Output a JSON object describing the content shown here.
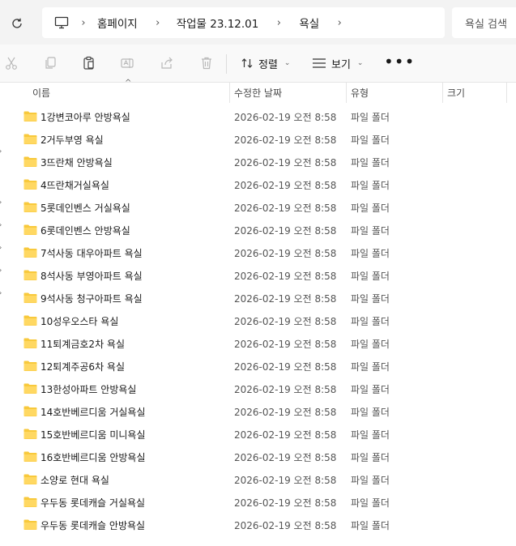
{
  "address": {
    "breadcrumbs": [
      "홈페이지",
      "작업물 23.12.01",
      "욕실"
    ],
    "search_placeholder": "욕실 검색"
  },
  "toolbar": {
    "sort_label": "정렬",
    "view_label": "보기",
    "icons": [
      "cut-icon",
      "copy-icon",
      "paste-icon",
      "rename-icon",
      "share-icon",
      "delete-icon"
    ]
  },
  "columns": {
    "name": "이름",
    "date": "수정한 날짜",
    "type": "유형",
    "size": "크기"
  },
  "folder_color": "#F8C93C",
  "files": [
    {
      "name": "1강변코아루 안방욕실",
      "date": "2026-02-19 오전 8:58",
      "type": "파일 폴더"
    },
    {
      "name": "2거두부영 욕실",
      "date": "2026-02-19 오전 8:58",
      "type": "파일 폴더"
    },
    {
      "name": "3뜨란채 안방욕실",
      "date": "2026-02-19 오전 8:58",
      "type": "파일 폴더"
    },
    {
      "name": "4뜨란채거실욕실",
      "date": "2026-02-19 오전 8:58",
      "type": "파일 폴더"
    },
    {
      "name": "5롯데인벤스 거실욕실",
      "date": "2026-02-19 오전 8:58",
      "type": "파일 폴더"
    },
    {
      "name": "6롯데인벤스 안방욕실",
      "date": "2026-02-19 오전 8:58",
      "type": "파일 폴더"
    },
    {
      "name": "7석사동 대우아파트 욕실",
      "date": "2026-02-19 오전 8:58",
      "type": "파일 폴더"
    },
    {
      "name": "8석사동 부영아파트 욕실",
      "date": "2026-02-19 오전 8:58",
      "type": "파일 폴더"
    },
    {
      "name": "9석사동 청구아파트 욕실",
      "date": "2026-02-19 오전 8:58",
      "type": "파일 폴더"
    },
    {
      "name": "10성우오스타 욕실",
      "date": "2026-02-19 오전 8:58",
      "type": "파일 폴더"
    },
    {
      "name": "11퇴계금호2차 욕실",
      "date": "2026-02-19 오전 8:58",
      "type": "파일 폴더"
    },
    {
      "name": "12퇴계주공6차 욕실",
      "date": "2026-02-19 오전 8:58",
      "type": "파일 폴더"
    },
    {
      "name": "13한성아파트 안방욕실",
      "date": "2026-02-19 오전 8:58",
      "type": "파일 폴더"
    },
    {
      "name": "14호반베르디움 거실욕실",
      "date": "2026-02-19 오전 8:58",
      "type": "파일 폴더"
    },
    {
      "name": "15호반베르디움 미니욕실",
      "date": "2026-02-19 오전 8:58",
      "type": "파일 폴더"
    },
    {
      "name": "16호반베르디움 안방욕실",
      "date": "2026-02-19 오전 8:58",
      "type": "파일 폴더"
    },
    {
      "name": "소양로 현대 욕실",
      "date": "2026-02-19 오전 8:58",
      "type": "파일 폴더"
    },
    {
      "name": "우두동 롯데캐슬 거실욕실",
      "date": "2026-02-19 오전 8:58",
      "type": "파일 폴더"
    },
    {
      "name": "우두동 롯데캐슬 안방욕실",
      "date": "2026-02-19 오전 8:58",
      "type": "파일 폴더"
    }
  ]
}
